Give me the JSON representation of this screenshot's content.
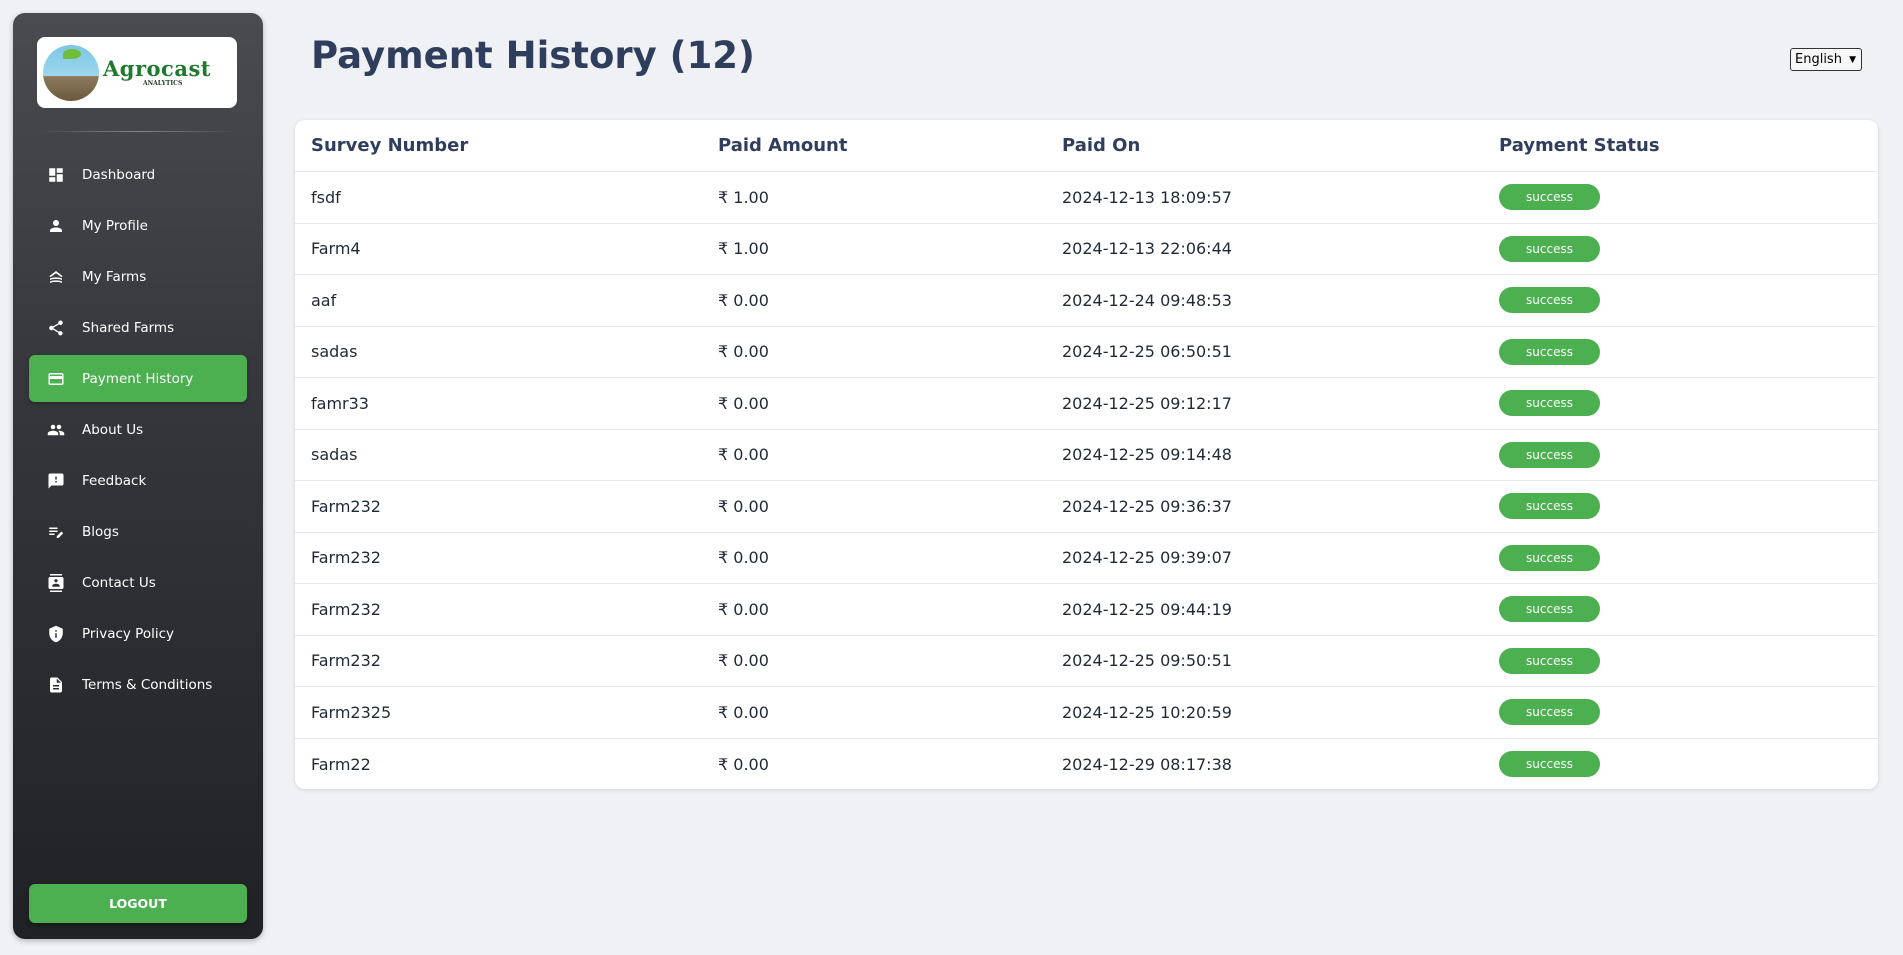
{
  "brand": {
    "logo_text": "Agrocast",
    "logo_subtext": "ANALYTICS"
  },
  "sidebar": {
    "items": [
      {
        "label": "Dashboard",
        "icon": "dashboard-icon"
      },
      {
        "label": "My Profile",
        "icon": "person-icon"
      },
      {
        "label": "My Farms",
        "icon": "farm-icon"
      },
      {
        "label": "Shared Farms",
        "icon": "share-icon"
      },
      {
        "label": "Payment History",
        "icon": "credit-card-icon",
        "active": true
      },
      {
        "label": "About Us",
        "icon": "group-icon"
      },
      {
        "label": "Feedback",
        "icon": "feedback-icon"
      },
      {
        "label": "Blogs",
        "icon": "edit-note-icon"
      },
      {
        "label": "Contact Us",
        "icon": "contact-icon"
      },
      {
        "label": "Privacy Policy",
        "icon": "shield-icon"
      },
      {
        "label": "Terms & Conditions",
        "icon": "document-icon"
      }
    ],
    "logout_label": "LOGOUT"
  },
  "header": {
    "title": "Payment History (12)",
    "language": "English"
  },
  "table": {
    "columns": [
      "Survey Number",
      "Paid Amount",
      "Paid On",
      "Payment Status"
    ],
    "rows": [
      [
        "fsdf",
        "₹ 1.00",
        "2024-12-13 18:09:57",
        "success"
      ],
      [
        "Farm4",
        "₹ 1.00",
        "2024-12-13 22:06:44",
        "success"
      ],
      [
        "aaf",
        "₹ 0.00",
        "2024-12-24 09:48:53",
        "success"
      ],
      [
        "sadas",
        "₹ 0.00",
        "2024-12-25 06:50:51",
        "success"
      ],
      [
        "famr33",
        "₹ 0.00",
        "2024-12-25 09:12:17",
        "success"
      ],
      [
        "sadas",
        "₹ 0.00",
        "2024-12-25 09:14:48",
        "success"
      ],
      [
        "Farm232",
        "₹ 0.00",
        "2024-12-25 09:36:37",
        "success"
      ],
      [
        "Farm232",
        "₹ 0.00",
        "2024-12-25 09:39:07",
        "success"
      ],
      [
        "Farm232",
        "₹ 0.00",
        "2024-12-25 09:44:19",
        "success"
      ],
      [
        "Farm232",
        "₹ 0.00",
        "2024-12-25 09:50:51",
        "success"
      ],
      [
        "Farm2325",
        "₹ 0.00",
        "2024-12-25 10:20:59",
        "success"
      ],
      [
        "Farm22",
        "₹ 0.00",
        "2024-12-29 08:17:38",
        "success"
      ]
    ]
  },
  "colors": {
    "accent": "#4caf50",
    "title": "#2f3e5c",
    "sidebar_top": "#4a4b51",
    "sidebar_bottom": "#202124",
    "background": "#f0f1f5"
  }
}
